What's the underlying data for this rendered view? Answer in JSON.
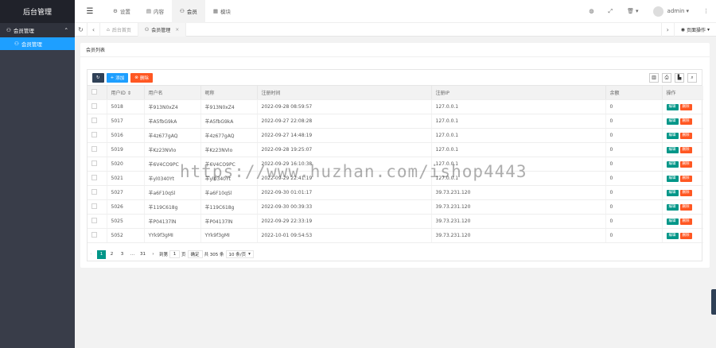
{
  "sidebar": {
    "logo": "后台管理",
    "group_label": "会员管理",
    "active_item": "会员管理"
  },
  "header": {
    "nav": [
      {
        "label": "设置"
      },
      {
        "label": "内容"
      },
      {
        "label": "会员"
      },
      {
        "label": "模块"
      }
    ],
    "username": "admin"
  },
  "tabs": {
    "items": [
      {
        "label": "后台首页"
      },
      {
        "label": "会员管理"
      }
    ],
    "page_ops": "页面操作"
  },
  "card": {
    "title": "会员列表",
    "toolbar": {
      "add_label": "添加",
      "delete_label": "删除"
    }
  },
  "table": {
    "columns": [
      "用户ID",
      "用户名",
      "昵称",
      "注册时间",
      "注册IP",
      "余额",
      "操作"
    ],
    "row_actions": {
      "edit": "编辑",
      "delete": "删除"
    },
    "rows": [
      [
        "5018",
        "羊913N0xZ4",
        "羊913N0xZ4",
        "2022-09-28 08:59:57",
        "127.0.0.1",
        "0"
      ],
      [
        "5017",
        "羊A5fbG9kA",
        "羊A5fbG9kA",
        "2022-09-27 22:08:28",
        "127.0.0.1",
        "0"
      ],
      [
        "5016",
        "羊4z677gAQ",
        "羊4z677gAQ",
        "2022-09-27 14:48:19",
        "127.0.0.1",
        "0"
      ],
      [
        "5019",
        "羊Kz23NVIo",
        "羊Kz23NVIo",
        "2022-09-28 19:25:07",
        "127.0.0.1",
        "0"
      ],
      [
        "5020",
        "羊6V4CO9PC",
        "羊6V4CO9PC",
        "2022-09-29 16:10:38",
        "127.0.0.1",
        "0"
      ],
      [
        "5021",
        "羊yl0340Yt",
        "羊yl0340Yt",
        "2022-09-29 22:41:19",
        "127.0.0.1",
        "0"
      ],
      [
        "5027",
        "羊a6F10qSl",
        "羊a6F10qSl",
        "2022-09-30 01:01:17",
        "39.73.231.120",
        "0"
      ],
      [
        "5026",
        "羊119C618g",
        "羊119C618g",
        "2022-09-30 00:39:33",
        "39.73.231.120",
        "0"
      ],
      [
        "5025",
        "羊P04137lN",
        "羊P04137lN",
        "2022-09-29 22:33:19",
        "39.73.231.120",
        "0"
      ],
      [
        "5052",
        "YYk9f3gMI",
        "YYk9f3gMI",
        "2022-10-01 09:54:53",
        "39.73.231.120",
        "0"
      ]
    ]
  },
  "pager": {
    "pages": [
      "1",
      "2",
      "3",
      "…",
      "31"
    ],
    "goto_label": "到第",
    "goto_value": "1",
    "page_unit": "页",
    "confirm": "确定",
    "total": "共 305 条",
    "page_size": "10 条/页"
  },
  "watermark": "https://www.huzhan.com/ishop4443"
}
